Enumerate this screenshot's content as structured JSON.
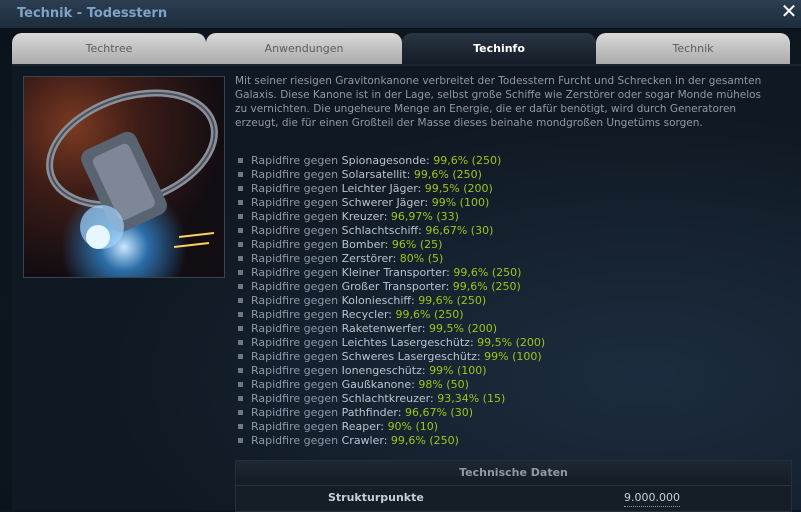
{
  "window": {
    "title": "Technik - Todesstern",
    "close_glyph": "✕"
  },
  "tabs": [
    {
      "label": "Techtree",
      "active": false
    },
    {
      "label": "Anwendungen",
      "active": false
    },
    {
      "label": "Techinfo",
      "active": true
    },
    {
      "label": "Technik",
      "active": false
    }
  ],
  "description": "Mit seiner riesigen Gravitonkanone verbreitet der Todesstern Furcht und Schrecken in der gesamten Galaxis. Diese Kanone ist in der Lage, selbst große Schiffe wie Zerstörer oder sogar Monde mühelos zu vernichten. Die ungeheure Menge an Energie, die er dafür benötigt, wird durch Generatoren erzeugt, die für einen Großteil der Masse dieses beinahe mondgroßen Ungetüms sorgen.",
  "rapidfire_prefix": "Rapidfire gegen",
  "rapidfire": [
    {
      "target": "Spionagesonde:",
      "value": "99,6% (250)"
    },
    {
      "target": "Solarsatellit:",
      "value": "99,6% (250)"
    },
    {
      "target": "Leichter Jäger:",
      "value": "99,5% (200)"
    },
    {
      "target": "Schwerer Jäger:",
      "value": "99% (100)"
    },
    {
      "target": "Kreuzer:",
      "value": "96,97% (33)"
    },
    {
      "target": "Schlachtschiff:",
      "value": "96,67% (30)"
    },
    {
      "target": "Bomber:",
      "value": "96% (25)"
    },
    {
      "target": "Zerstörer:",
      "value": "80% (5)"
    },
    {
      "target": "Kleiner Transporter:",
      "value": "99,6% (250)"
    },
    {
      "target": "Großer Transporter:",
      "value": "99,6% (250)"
    },
    {
      "target": "Kolonieschiff:",
      "value": "99,6% (250)"
    },
    {
      "target": "Recycler:",
      "value": "99,6% (250)"
    },
    {
      "target": "Raketenwerfer:",
      "value": "99,5% (200)"
    },
    {
      "target": "Leichtes Lasergeschütz:",
      "value": "99,5% (200)"
    },
    {
      "target": "Schweres Lasergeschütz:",
      "value": "99% (100)"
    },
    {
      "target": "Ionengeschütz:",
      "value": "99% (100)"
    },
    {
      "target": "Gaußkanone:",
      "value": "98% (50)"
    },
    {
      "target": "Schlachtkreuzer:",
      "value": "93,34% (15)"
    },
    {
      "target": "Pathfinder:",
      "value": "96,67% (30)"
    },
    {
      "target": "Reaper:",
      "value": "90% (10)"
    },
    {
      "target": "Crawler:",
      "value": "99,6% (250)"
    }
  ],
  "tech_data": {
    "header": "Technische Daten",
    "rows": [
      {
        "key": "Strukturpunkte",
        "value": "9.000.000"
      }
    ]
  },
  "colors": {
    "title": "#7fa3c8",
    "value_green": "#9cc61a",
    "text": "#8e9aa6"
  },
  "icons": {
    "close": "close-icon",
    "bullet": "square-bullet-icon"
  }
}
